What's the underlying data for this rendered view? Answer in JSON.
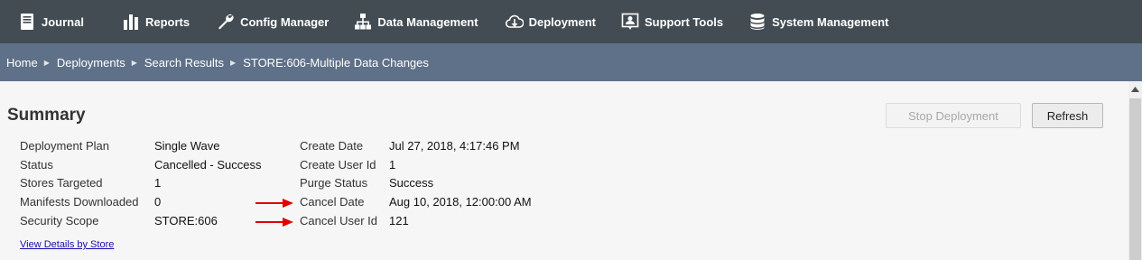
{
  "nav": {
    "journal": "Journal",
    "reports": "Reports",
    "config_manager": "Config Manager",
    "data_management": "Data Management",
    "deployment": "Deployment",
    "support_tools": "Support Tools",
    "system_management": "System Management"
  },
  "breadcrumb": {
    "home": "Home",
    "deployments": "Deployments",
    "search_results": "Search Results",
    "current": "STORE:606-Multiple Data Changes"
  },
  "summary": {
    "title": "Summary",
    "stop_label": "Stop Deployment",
    "refresh_label": "Refresh",
    "left": [
      {
        "label": "Deployment Plan",
        "value": "Single Wave"
      },
      {
        "label": "Status",
        "value": "Cancelled - Success"
      },
      {
        "label": "Stores Targeted",
        "value": "1"
      },
      {
        "label": "Manifests Downloaded",
        "value": "0"
      },
      {
        "label": "Security Scope",
        "value": "STORE:606"
      }
    ],
    "right": [
      {
        "label": "Create Date",
        "value": "Jul 27, 2018, 4:17:46 PM"
      },
      {
        "label": "Create User Id",
        "value": "1"
      },
      {
        "label": "Purge Status",
        "value": "Success"
      },
      {
        "label": "Cancel Date",
        "value": "Aug 10, 2018, 12:00:00 AM"
      },
      {
        "label": "Cancel User Id",
        "value": "121"
      }
    ],
    "details_link": "View Details by Store"
  },
  "colors": {
    "nav_bg": "#434c53",
    "breadcrumb_bg": "#5f7188",
    "arrow": "#e00000"
  }
}
